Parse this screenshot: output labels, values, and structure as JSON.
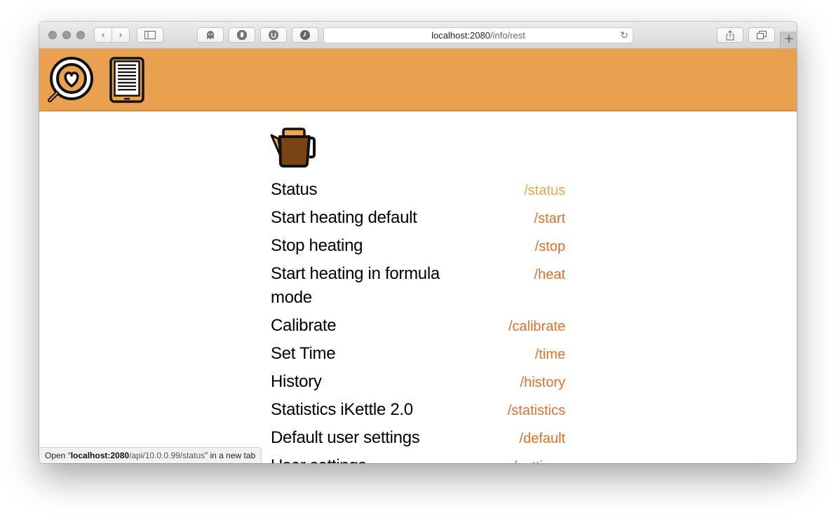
{
  "browser": {
    "url_host": "localhost:2080",
    "url_path": "/info/rest",
    "reload_icon": "reload-icon",
    "new_tab_symbol": "+"
  },
  "header": {
    "logo_icon": "coffee-heart-magnifier-icon",
    "doc_icon": "tablet-document-icon",
    "color": "#e9a14f"
  },
  "main": {
    "kettle_icon": "kettle-icon",
    "rows": [
      {
        "label": "Status",
        "endpoint": "/status"
      },
      {
        "label": "Start heating default",
        "endpoint": "/start"
      },
      {
        "label": "Stop heating",
        "endpoint": "/stop"
      },
      {
        "label": "Start heating in formula mode",
        "endpoint": "/heat"
      },
      {
        "label": "Calibrate",
        "endpoint": "/calibrate"
      },
      {
        "label": "Set Time",
        "endpoint": "/time"
      },
      {
        "label": "History",
        "endpoint": "/history"
      },
      {
        "label": "Statistics iKettle 2.0",
        "endpoint": "/statistics"
      },
      {
        "label": "Default user settings",
        "endpoint": "/default"
      },
      {
        "label": "User settings",
        "endpoint": "/settings"
      }
    ]
  },
  "statusbar": {
    "prefix": "Open “",
    "host": "localhost:2080",
    "path": "/api/10.0.0.99/status",
    "suffix": "” in a new tab"
  },
  "colors": {
    "endpoint": "#e0722b",
    "endpoint_hover": "#eda64f",
    "kettle_body": "#7a4415",
    "kettle_lid": "#eda64f"
  }
}
